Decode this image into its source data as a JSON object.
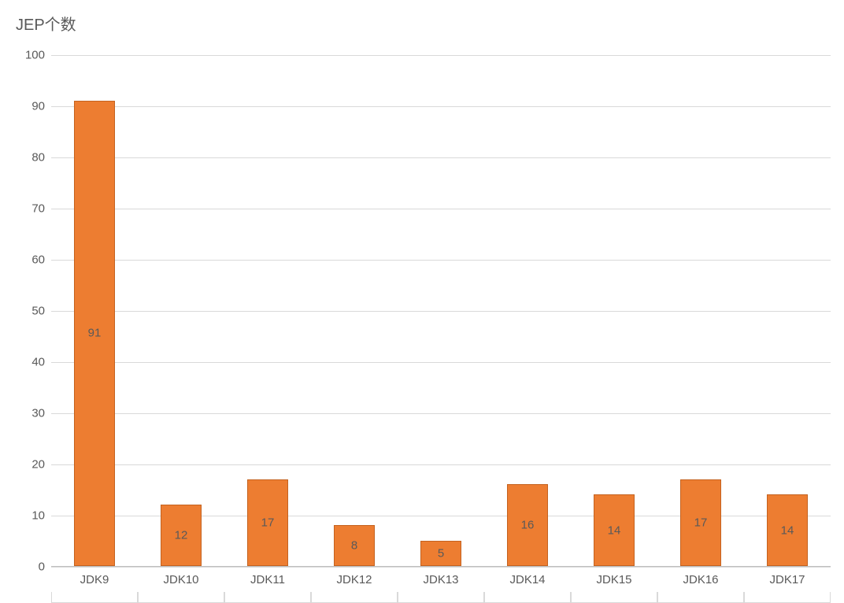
{
  "chart_data": {
    "type": "bar",
    "title": "JEP个数",
    "categories": [
      "JDK9",
      "JDK10",
      "JDK11",
      "JDK12",
      "JDK13",
      "JDK14",
      "JDK15",
      "JDK16",
      "JDK17"
    ],
    "values": [
      91,
      12,
      17,
      8,
      5,
      16,
      14,
      17,
      14
    ],
    "ylim": [
      0,
      100
    ],
    "ystep": 10,
    "xlabel": "",
    "ylabel": ""
  },
  "colors": {
    "bar_fill": "#ed7d31",
    "bar_border": "#c4621f",
    "text": "#595959",
    "gridline": "#d9d9d9"
  }
}
